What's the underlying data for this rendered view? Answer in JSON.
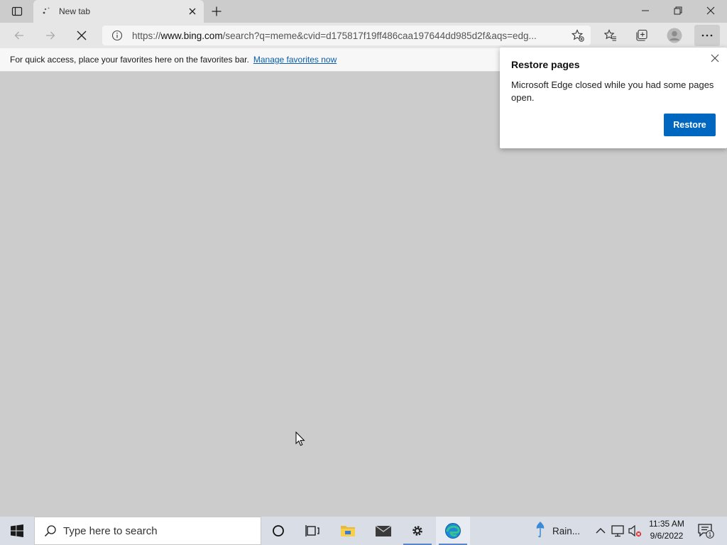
{
  "browser": {
    "tab": {
      "title": "New tab"
    },
    "address": {
      "scheme": "https://",
      "host": "www.bing.com",
      "path": "/search?q=meme&cvid=d175817f19ff486caa197644dd985d2f&aqs=edg..."
    },
    "favorites_bar": {
      "message": "For quick access, place your favorites here on the favorites bar.",
      "link": "Manage favorites now"
    }
  },
  "restore_popup": {
    "title": "Restore pages",
    "message": "Microsoft Edge closed while you had some pages open.",
    "button": "Restore"
  },
  "taskbar": {
    "search_placeholder": "Type here to search",
    "weather": "Rain...",
    "time": "11:35 AM",
    "date": "9/6/2022",
    "notification_count": "1"
  },
  "colors": {
    "accent": "#0067c0",
    "link": "#0b5cad",
    "page_background": "#cccccc",
    "taskbar": "#d8dde6"
  },
  "icons": [
    "tab-actions-icon",
    "spinner-icon",
    "close-icon",
    "plus-icon",
    "minimize-icon",
    "restore-icon",
    "back-arrow-icon",
    "forward-arrow-icon",
    "stop-icon",
    "info-icon",
    "add-favorite-icon",
    "favorites-icon",
    "collections-icon",
    "profile-icon",
    "more-icon",
    "windows-logo-icon",
    "search-icon",
    "cortana-icon",
    "task-view-icon",
    "file-explorer-icon",
    "mail-icon",
    "settings-icon",
    "edge-icon",
    "weather-icon",
    "chevron-up-icon",
    "network-icon",
    "volume-muted-icon",
    "notification-icon"
  ]
}
